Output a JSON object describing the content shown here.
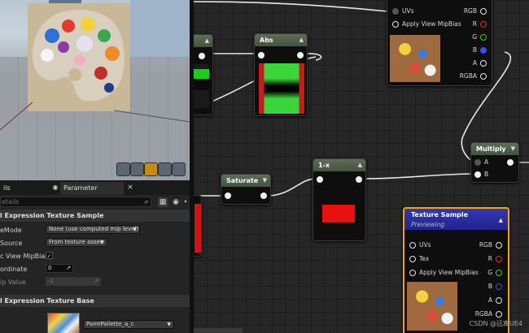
{
  "details": {
    "tabs": [
      {
        "label": "ils"
      },
      {
        "label": "Parameter Defaults"
      }
    ],
    "search_placeholder": "etails",
    "section1_title": "l Expression Texture Sample",
    "props": [
      {
        "label": "eMode",
        "value": "None (use computed mip level)"
      },
      {
        "label": "Source",
        "value": "From texture asset"
      },
      {
        "label": "c View MipBias",
        "checked": true
      },
      {
        "label": "ordinate",
        "value": "0"
      },
      {
        "label": "ip Value",
        "value": "-1"
      }
    ],
    "section2_title": "l Expression Texture Base",
    "texture_name": "PaintPallette_a_c"
  },
  "graph": {
    "top_sample": {
      "inputs": [
        "UVs",
        "Apply View MipBias"
      ],
      "outputs": [
        "RGB",
        "R",
        "G",
        "B",
        "A",
        "RGBA"
      ]
    },
    "abs_title": "Abs",
    "saturate_title": "Saturate",
    "oneminus_title": "1-x",
    "multiply_title": "Multiply",
    "multiply_inputs": [
      "A",
      "B"
    ],
    "texture_sample": {
      "title": "Texture Sample",
      "status": "Previewing",
      "inputs": [
        "UVs",
        "Tex",
        "Apply View MipBias"
      ],
      "outputs": [
        "RGB",
        "R",
        "G",
        "B",
        "A",
        "RGBA"
      ]
    }
  },
  "colors": {
    "pin_red": "#e03030",
    "pin_green": "#30d030",
    "pin_blue": "#3050f0",
    "selection": "#e8a817",
    "texture_header": "#2b2ea8"
  },
  "watermark": "CSDN @远离UE4"
}
